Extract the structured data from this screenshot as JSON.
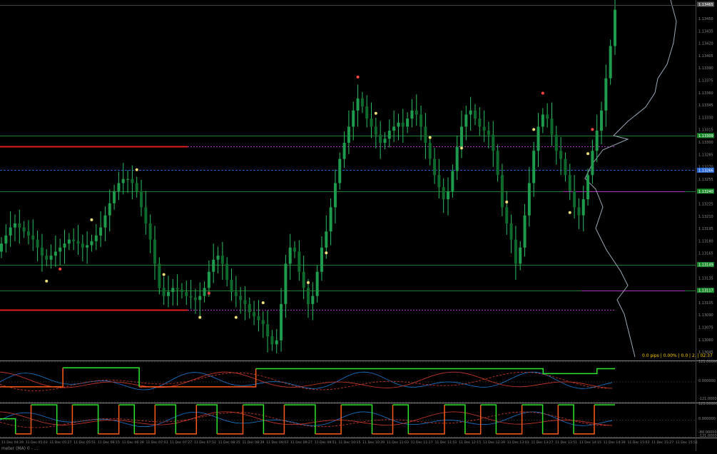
{
  "colors": {
    "background": "#000000",
    "bull": "#1e9b4c",
    "bear": "#0d6a2c",
    "wick": "#2bbf5f",
    "level_green": "#1f7a2e",
    "level_red": "#e02020",
    "level_magenta": "#b030c0",
    "blue_dashed": "#2a5ad8",
    "volume_profile": "#9aa8b8",
    "dot_yellow": "#f2e07a",
    "dot_red": "#ff4444",
    "osc_green": "#2ee62e",
    "osc_orange": "#ff5a1a",
    "osc_blue": "#1e7ad2",
    "osc_red_thin": "#d23a2a",
    "separator": "#888888",
    "axis_text": "#8c8c8c",
    "info_text": "#ffcc00",
    "price_box_green": "#1a8a2a",
    "price_box_blue": "#2a6ad8"
  },
  "status_text": "0.0 pips | 0.00% | 0.0 | 2. | 02:37",
  "bottom_left_label": "meter (MA) 0 - ...",
  "right_axis_labels": {
    "main": [
      "1.13450",
      "1.13435",
      "1.13420",
      "1.13405",
      "1.13390",
      "1.13375",
      "1.13360",
      "1.13345",
      "1.13330",
      "1.13315",
      "1.13300",
      "1.13285",
      "1.13270",
      "1.13255",
      "1.13240",
      "1.13225",
      "1.13210",
      "1.13195",
      "1.13180",
      "1.13165",
      "1.13150",
      "1.13135",
      "1.13120",
      "1.13105",
      "1.13090",
      "1.13075",
      "1.13060",
      "1.13045"
    ],
    "osc1": [
      "121.000000",
      "0.000000",
      "-121.000000"
    ],
    "osc2": [
      "121.000000",
      "0.000000",
      "-80.000000",
      "-121.000000"
    ],
    "price_boxes": [
      {
        "value": "1.13465",
        "kind": "current"
      },
      {
        "value": "1.13309",
        "kind": "green"
      },
      {
        "value": "1.13266",
        "kind": "blue"
      },
      {
        "value": "1.13240",
        "kind": "green"
      },
      {
        "value": "1.13149",
        "kind": "green"
      },
      {
        "value": "1.13117",
        "kind": "green"
      }
    ]
  },
  "time_labels": [
    "11 Dec 04:39",
    "11 Dec 05:03",
    "11 Dec 05:27",
    "11 Dec 05:51",
    "11 Dec 06:15",
    "11 Dec 06:39",
    "11 Dec 07:03",
    "11 Dec 07:27",
    "11 Dec 07:51",
    "11 Dec 08:15",
    "11 Dec 08:39",
    "11 Dec 09:03",
    "11 Dec 09:27",
    "11 Dec 09:51",
    "11 Dec 10:15",
    "11 Dec 10:39",
    "11 Dec 11:03",
    "11 Dec 11:27",
    "11 Dec 11:51",
    "11 Dec 12:15",
    "11 Dec 12:39",
    "11 Dec 13:03",
    "11 Dec 13:27",
    "11 Dec 13:51",
    "11 Dec 14:15",
    "11 Dec 14:39",
    "11 Dec 15:03",
    "11 Dec 15:27",
    "11 Dec 15:51"
  ],
  "chart_data": {
    "type": "candlestick",
    "symbol": "",
    "timeframe": "",
    "ylim": [
      1.1303,
      1.1347
    ],
    "levels": [
      {
        "price": 1.13309,
        "style": "green-solid"
      },
      {
        "price": 1.13296,
        "style": "red-then-magenta-dashed",
        "split_index": 87
      },
      {
        "price": 1.13266,
        "style": "blue-dashed"
      },
      {
        "price": 1.1324,
        "style": "green-solid-with-magenta-tail",
        "tail_start": 264
      },
      {
        "price": 1.13149,
        "style": "green-solid"
      },
      {
        "price": 1.13117,
        "style": "green-solid"
      },
      {
        "price": 1.13093,
        "style": "red-then-magenta-dashed",
        "split_index": 87
      }
    ],
    "close_path": [
      1.13175,
      1.13185,
      1.13195,
      1.132,
      1.13195,
      1.1319,
      1.13185,
      1.1318,
      1.1317,
      1.1316,
      1.13155,
      1.1316,
      1.13165,
      1.1317,
      1.13175,
      1.1318,
      1.13178,
      1.13175,
      1.1317,
      1.13173,
      1.13178,
      1.13185,
      1.13195,
      1.1321,
      1.13225,
      1.1324,
      1.1325,
      1.13255,
      1.13255,
      1.1325,
      1.1324,
      1.1322,
      1.132,
      1.1318,
      1.1315,
      1.1312,
      1.1311,
      1.13115,
      1.1312,
      1.13118,
      1.13115,
      1.1311,
      1.13108,
      1.13105,
      1.1311,
      1.1312,
      1.1314,
      1.13155,
      1.1316,
      1.1315,
      1.1313,
      1.13115,
      1.1311,
      1.13105,
      1.131,
      1.1309,
      1.13085,
      1.1308,
      1.13075,
      1.1306,
      1.1305,
      1.13055,
      1.131,
      1.1315,
      1.1317,
      1.13165,
      1.1314,
      1.1312,
      1.131,
      1.1311,
      1.1314,
      1.1317,
      1.1319,
      1.1322,
      1.1325,
      1.1328,
      1.133,
      1.1332,
      1.1334,
      1.13355,
      1.13345,
      1.1333,
      1.1332,
      1.1331,
      1.133,
      1.13305,
      1.13315,
      1.1332,
      1.13325,
      1.1332,
      1.1333,
      1.1334,
      1.13335,
      1.1332,
      1.133,
      1.1328,
      1.1326,
      1.13245,
      1.1323,
      1.1324,
      1.13265,
      1.13295,
      1.1332,
      1.13335,
      1.1334,
      1.1333,
      1.1332,
      1.13315,
      1.1331,
      1.1329,
      1.1326,
      1.1322,
      1.132,
      1.1318,
      1.1315,
      1.1317,
      1.1321,
      1.1325,
      1.1329,
      1.1332,
      1.13335,
      1.1333,
      1.1331,
      1.1329,
      1.1328,
      1.1326,
      1.1324,
      1.1322,
      1.1321,
      1.1323,
      1.1326,
      1.1329,
      1.13315,
      1.1334,
      1.1338,
      1.1342,
      1.13465
    ],
    "oscillator_1": {
      "ylim": [
        -121,
        121
      ],
      "step_values": [
        -30,
        -30,
        -30,
        -30,
        -30,
        -30,
        -30,
        -30,
        -30,
        -30,
        -30,
        -30,
        -30,
        -30,
        85,
        85,
        85,
        85,
        85,
        85,
        85,
        85,
        85,
        85,
        85,
        85,
        85,
        85,
        85,
        85,
        85,
        -30,
        -30,
        -30,
        -30,
        -30,
        -30,
        -30,
        -30,
        -30,
        -30,
        -30,
        -30,
        -30,
        -30,
        -30,
        -30,
        -30,
        -30,
        -30,
        -30,
        -30,
        -30,
        -30,
        -30,
        -30,
        -30,
        80,
        80,
        80,
        80,
        80,
        80,
        80,
        80,
        80,
        80,
        80,
        80,
        80,
        80,
        80,
        80,
        80,
        80,
        80,
        80,
        80,
        80,
        80,
        80,
        80,
        80,
        80,
        80,
        80,
        80,
        80,
        80,
        80,
        80,
        80,
        80,
        80,
        80,
        80,
        80,
        80,
        80,
        80,
        80,
        80,
        80,
        80,
        80,
        80,
        80,
        80,
        80,
        80,
        80,
        80,
        80,
        80,
        80,
        80,
        80,
        80,
        80,
        80,
        80,
        50,
        50,
        50,
        50,
        50,
        50,
        50,
        50,
        50,
        50,
        50,
        50,
        80,
        80,
        80,
        80,
        80
      ]
    },
    "oscillator_2": {
      "ylim": [
        -121,
        121
      ],
      "step_values": [
        10,
        10,
        10,
        -100,
        -100,
        -100,
        110,
        110,
        110,
        110,
        110,
        -100,
        -100,
        -100,
        110,
        110,
        110,
        110,
        110,
        -100,
        -100,
        -100,
        -100,
        110,
        110,
        110,
        -100,
        -100,
        -100,
        -100,
        110,
        110,
        110,
        110,
        -100,
        -100,
        -100,
        -100,
        110,
        110,
        110,
        110,
        -100,
        -100,
        -100,
        -100,
        -100,
        110,
        110,
        110,
        110,
        -100,
        -100,
        -100,
        -100,
        110,
        110,
        110,
        110,
        110,
        110,
        -100,
        -100,
        -100,
        -100,
        -100,
        110,
        110,
        110,
        110,
        110,
        110,
        -100,
        -100,
        -100,
        -100,
        110,
        110,
        110,
        -100,
        -100,
        -100,
        -100,
        -100,
        -100,
        -100,
        110,
        110,
        110,
        110,
        -100,
        -100,
        -100,
        110,
        110,
        110,
        -100,
        -100,
        -100,
        -100,
        -100,
        110,
        110,
        110,
        110,
        -100,
        -100,
        -100,
        110,
        110,
        110,
        -100,
        -100,
        -100,
        -100,
        110,
        110,
        110,
        110,
        110
      ]
    }
  }
}
